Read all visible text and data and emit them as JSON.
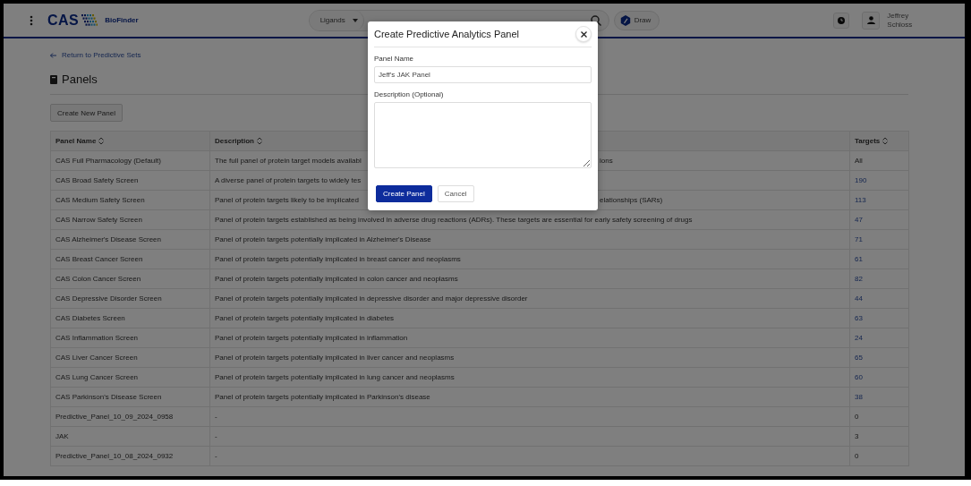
{
  "header": {
    "brand": "CAS",
    "product": "BioFinder",
    "search_type": "Ligands",
    "draw_button": "Draw",
    "user": [
      "Jeffrey",
      "Schloss"
    ]
  },
  "page": {
    "back_link": "Return to Predictive Sets",
    "title": "Panels",
    "create_button": "Create New Panel"
  },
  "table": {
    "columns": [
      "Panel Name",
      "Description",
      "Targets"
    ],
    "rows": [
      {
        "name": "CAS Full Pharmacology (Default)",
        "description": "The full panel of protein target models availabl",
        "description_tail": "ions",
        "targets": "All",
        "linked": false
      },
      {
        "name": "CAS Broad Safety Screen",
        "description": "A diverse panel of protein targets to widely tes",
        "targets": "190",
        "linked": true
      },
      {
        "name": "CAS Medium Safety Screen",
        "description": "Panel of protein targets likely to be implicated",
        "description_tail": "elationships (SARs)",
        "targets": "113",
        "linked": true
      },
      {
        "name": "CAS Narrow Safety Screen",
        "description": "Panel of protein targets established as being involved in adverse drug reactions (ADRs). These targets are essential for early safety screening of drugs",
        "targets": "47",
        "linked": true
      },
      {
        "name": "CAS Alzheimer's Disease Screen",
        "description": "Panel of protein targets potentially implicated in Alzheimer's Disease",
        "targets": "71",
        "linked": true
      },
      {
        "name": "CAS Breast Cancer Screen",
        "description": "Panel of protein targets potentially implicated in breast cancer and neoplasms",
        "targets": "61",
        "linked": true
      },
      {
        "name": "CAS Colon Cancer Screen",
        "description": "Panel of protein targets potentially implicated in colon cancer and neoplasms",
        "targets": "82",
        "linked": true
      },
      {
        "name": "CAS Depressive Disorder Screen",
        "description": "Panel of protein targets potentially implicated in depressive disorder and major depressive disorder",
        "targets": "44",
        "linked": true
      },
      {
        "name": "CAS Diabetes Screen",
        "description": "Panel of protein targets potentially implicated in diabetes",
        "targets": "63",
        "linked": true
      },
      {
        "name": "CAS Inflammation Screen",
        "description": "Panel of protein targets potentially implicated in inflammation",
        "targets": "24",
        "linked": true
      },
      {
        "name": "CAS Liver Cancer Screen",
        "description": "Panel of protein targets potentially implicated in liver cancer and neoplasms",
        "targets": "65",
        "linked": true
      },
      {
        "name": "CAS Lung Cancer Screen",
        "description": "Panel of protein targets potentially implicated in lung cancer and neoplasms",
        "targets": "60",
        "linked": true
      },
      {
        "name": "CAS Parkinson's Disease Screen",
        "description": "Panel of protein targets potentially implicated in Parkinson's disease",
        "targets": "38",
        "linked": true
      },
      {
        "name": "Predictive_Panel_10_09_2024_0958",
        "description": "-",
        "targets": "0",
        "linked": false
      },
      {
        "name": "JAK",
        "description": "-",
        "targets": "3",
        "linked": false
      },
      {
        "name": "Predictive_Panel_10_08_2024_0932",
        "description": "-",
        "targets": "0",
        "linked": false
      }
    ]
  },
  "dialog": {
    "title": "Create Predictive Analytics Panel",
    "fields": [
      {
        "kind": "text",
        "label": "Panel Name",
        "value": "Jeff's JAK Panel"
      },
      {
        "kind": "textarea",
        "label": "Description (Optional)"
      }
    ],
    "buttons": [
      {
        "label": "Create Panel",
        "primary": true
      },
      {
        "label": "Cancel",
        "primary": false
      }
    ]
  }
}
